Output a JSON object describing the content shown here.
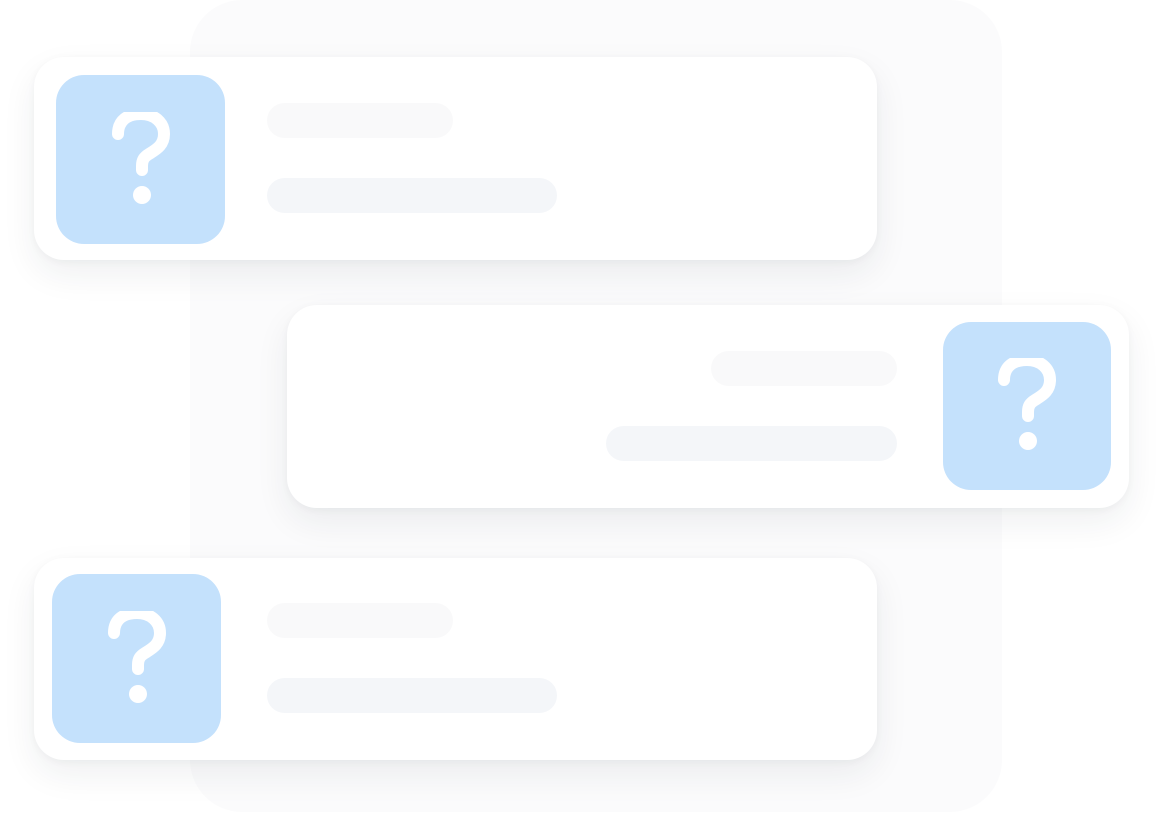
{
  "colors": {
    "avatar_fill": "#c4e1fc",
    "icon_color": "#ffffff",
    "bar_short": "#f9f9fa",
    "bar_long": "#f4f6f9"
  },
  "cards": [
    {
      "avatar_icon": "question-mark-icon",
      "avatar_side": "left"
    },
    {
      "avatar_icon": "question-mark-icon",
      "avatar_side": "right"
    },
    {
      "avatar_icon": "question-mark-icon",
      "avatar_side": "left"
    }
  ]
}
